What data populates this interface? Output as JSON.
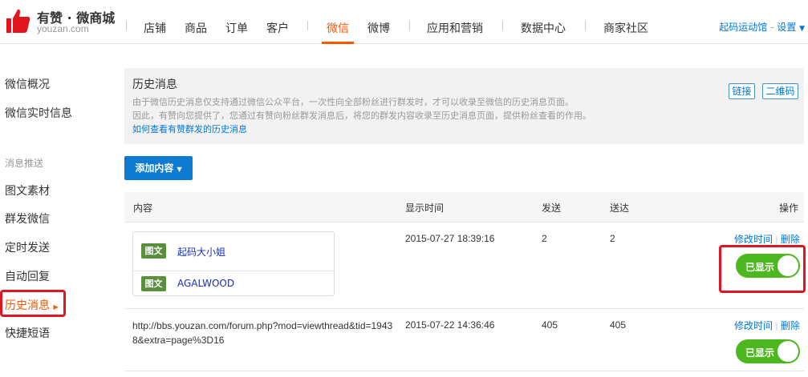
{
  "brand": {
    "title": "有赞 · 微商城",
    "subtitle": "youzan.com",
    "logo_icon": "thumbs-up-icon",
    "logo_color": "#e0151f"
  },
  "nav": {
    "items": [
      "店铺",
      "商品",
      "订单",
      "客户",
      "微信",
      "微博",
      "应用和营销",
      "数据中心",
      "商家社区"
    ],
    "active": "微信",
    "store_link": "起码运动馆",
    "separator": " - ",
    "settings": "设置",
    "settings_icon": "caret-down-icon"
  },
  "sidebar": {
    "top_items": [
      "微信概况",
      "微信实时信息"
    ],
    "group_label": "消息推送",
    "items": [
      "图文素材",
      "群发微信",
      "定时发送",
      "自动回复",
      "历史消息",
      "快捷短语"
    ],
    "active": "历史消息",
    "active_icon": "caret-right-icon"
  },
  "info": {
    "title": "历史消息",
    "line1": "由于微信历史消息仅支持通过微信公众平台，一次性向全部粉丝进行群发时，才可以收录至微信的历史消息页面。",
    "line2": "因此，有赞向您提供了，您通过有赞向粉丝群发消息后，将您的群发内容收录至历史消息页面，提供粉丝查看的作用。",
    "help_link": "如何查看有赞群发的历史消息",
    "btn_link": "链接",
    "btn_qr": "二维码"
  },
  "add_button": {
    "label": "添加内容",
    "icon": "caret-down-icon"
  },
  "table": {
    "headers": {
      "content": "内容",
      "time": "显示时间",
      "sent": "发送",
      "delivered": "送达",
      "actions": "操作"
    },
    "rows": [
      {
        "items": [
          {
            "tag": "图文",
            "title": "起码大小姐"
          },
          {
            "tag": "图文",
            "title": "AGALWOOD"
          }
        ],
        "time": "2015-07-27 18:39:16",
        "sent": "2",
        "delivered": "2",
        "edit": "修改时间",
        "delete": "删除",
        "toggle": "已显示"
      },
      {
        "url": "http://bbs.youzan.com/forum.php?mod=viewthread&tid=19438&extra=page%3D16",
        "time": "2015-07-22 14:36:46",
        "sent": "405",
        "delivered": "405",
        "edit": "修改时间",
        "delete": "删除",
        "toggle": "已显示"
      }
    ]
  },
  "colors": {
    "accent": "#ff5500",
    "link": "#0077dd",
    "primary_button": "#0e7bd1",
    "toggle_on": "#4cb71f",
    "tag_bg": "#5a8f3e",
    "highlight": "#e0151f"
  }
}
